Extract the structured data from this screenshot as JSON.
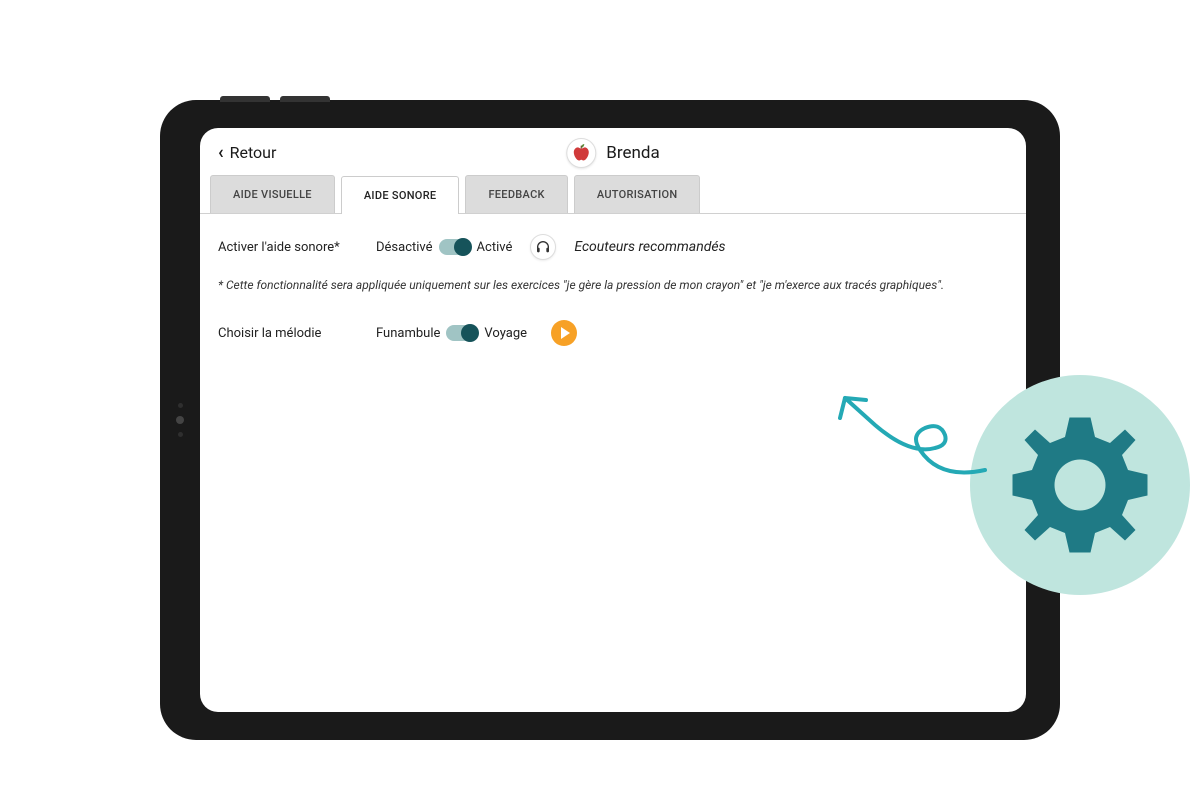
{
  "header": {
    "back_label": "Retour",
    "profile_name": "Brenda",
    "profile_icon": "apple"
  },
  "tabs": {
    "items": [
      {
        "label": "AIDE VISUELLE",
        "active": false
      },
      {
        "label": "AIDE SONORE",
        "active": true
      },
      {
        "label": "FEEDBACK",
        "active": false
      },
      {
        "label": "AUTORISATION",
        "active": false
      }
    ]
  },
  "sound_aid": {
    "enable_label": "Activer l'aide sonore*",
    "toggle_off": "Désactivé",
    "toggle_on": "Activé",
    "toggle_state": "on",
    "headphones_text": "Ecouteurs recommandés",
    "note": "* Cette fonctionnalité sera appliquée uniquement sur les exercices \"je gère la pression de mon crayon\" et \"je m'exerce aux tracés graphiques\"."
  },
  "melody": {
    "label": "Choisir la mélodie",
    "option_a": "Funambule",
    "option_b": "Voyage",
    "toggle_state": "on"
  },
  "colors": {
    "accent": "#16535a",
    "play": "#f7a126",
    "gear_bg": "#bfe5de",
    "gear_fg": "#1f7a85",
    "arrow": "#24a9b5"
  }
}
